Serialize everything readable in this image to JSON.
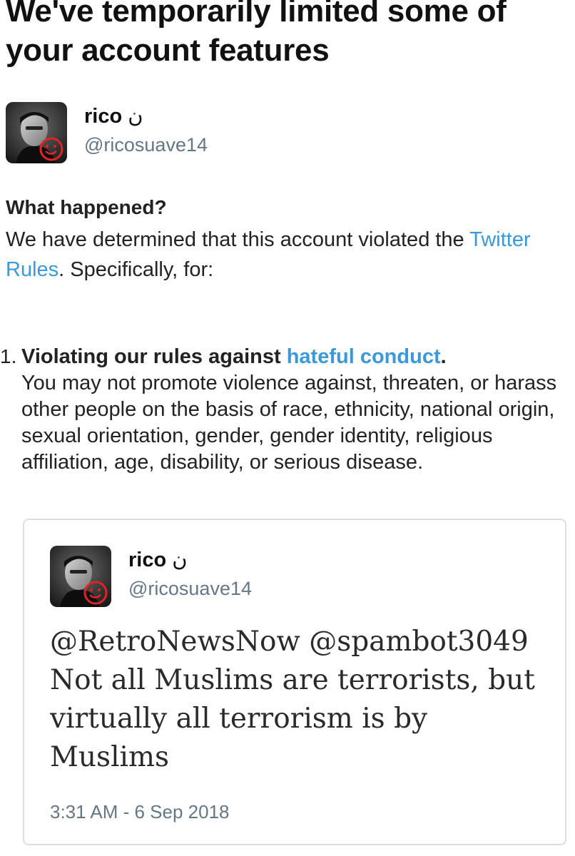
{
  "page": {
    "title": "We've temporarily limited some of your account features"
  },
  "account": {
    "display_name": "rico",
    "name_suffix": "ن",
    "handle": "@ricosuave14",
    "avatar_icon": "profile-photo"
  },
  "what_happened": {
    "heading": "What happened?",
    "text_before_link": "We have determined that this account violated the ",
    "rules_link": "Twitter Rules",
    "text_after_link": ". Specifically, for:"
  },
  "violations": [
    {
      "number": "1.",
      "title_prefix": "Violating our rules against ",
      "title_link": "hateful conduct",
      "title_suffix": ".",
      "description": "You may not promote violence against, threaten, or harass other people on the basis of race, ethnicity, national origin, sexual orientation, gender, gender identity, religious affiliation, age, disability, or serious disease."
    }
  ],
  "tweet": {
    "author_name": "rico",
    "author_suffix": "ن",
    "author_handle": "@ricosuave14",
    "text": "@RetroNewsNow @spambot3049 Not all Muslims are terrorists, but virtually all terrorism is by Muslims",
    "timestamp": "3:31 AM - 6 Sep 2018"
  },
  "colors": {
    "link": "#3a99d8",
    "secondary_text": "#657786",
    "card_border": "#dcdfe2"
  }
}
